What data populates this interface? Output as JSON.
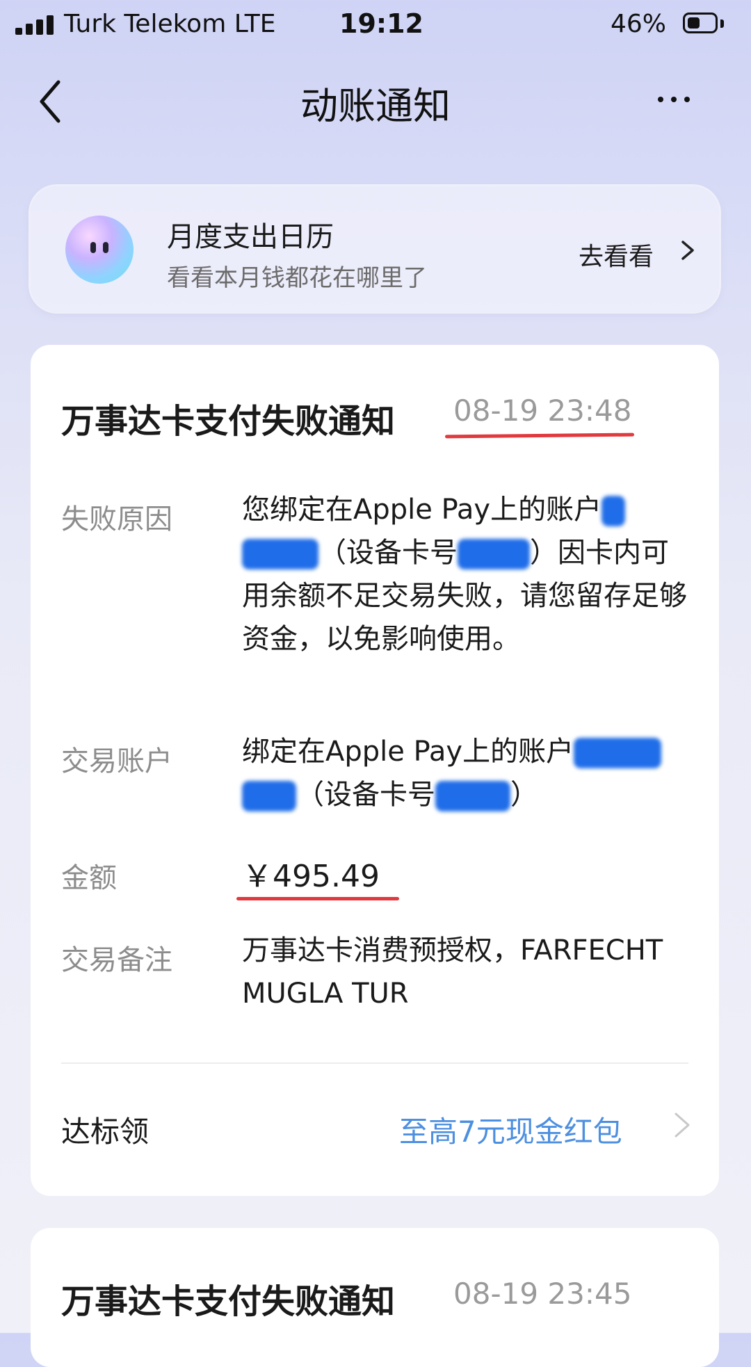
{
  "status_bar": {
    "carrier": "Turk Telekom  LTE",
    "time": "19:12",
    "battery": "46%",
    "battery_level": 0.46
  },
  "nav": {
    "title": "动账通知"
  },
  "banner": {
    "title": "月度支出日历",
    "subtitle": "看看本月钱都花在哪里了",
    "link": "去看看"
  },
  "notices": [
    {
      "title": "万事达卡支付失败通知",
      "time": "08-19 23:48",
      "rows": [
        {
          "label": "失败原因",
          "value_parts": [
            "您绑定在Apple Pay上的账户",
            "（设备卡号",
            "）因卡内可用余额不足交易失败，请您留存足够资金，以免影响使用。"
          ]
        },
        {
          "label": "交易账户",
          "value_parts": [
            "绑定在Apple Pay上的账户",
            "（设备卡号",
            "）"
          ]
        },
        {
          "label": "金额",
          "value": "￥495.49"
        },
        {
          "label": "交易备注",
          "value": "万事达卡消费预授权，FARFECHT MUGLA TUR"
        }
      ],
      "reward": {
        "label": "达标领",
        "link": "至高7元现金红包"
      }
    },
    {
      "title": "万事达卡支付失败通知",
      "time": "08-19 23:45"
    }
  ],
  "colors": {
    "accent_link": "#4d8fe0",
    "highlight_underline": "#e0393e",
    "redaction": "#1f6de8"
  }
}
